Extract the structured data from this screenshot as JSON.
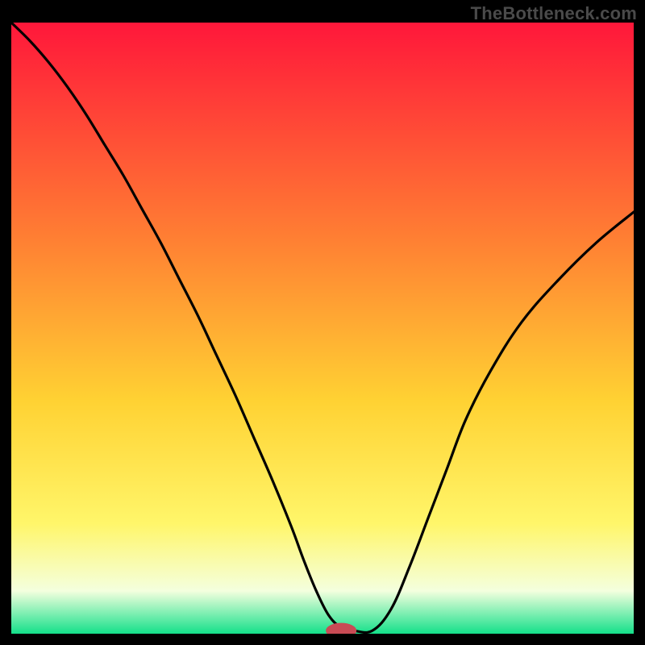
{
  "watermark": "TheBottleneck.com",
  "colors": {
    "gradient_top": "#ff173a",
    "gradient_mid_upper": "#ff7e33",
    "gradient_mid": "#ffd233",
    "gradient_mid_lower": "#fff66a",
    "gradient_light": "#f4ffde",
    "gradient_bottom": "#14e08a",
    "curve": "#000000",
    "marker": "#c94b55",
    "frame": "#000000"
  },
  "chart_data": {
    "type": "line",
    "title": "",
    "xlabel": "",
    "ylabel": "",
    "xlim": [
      0,
      100
    ],
    "ylim": [
      0,
      100
    ],
    "x": [
      0,
      3,
      6,
      9,
      12,
      15,
      18,
      21,
      24,
      27,
      30,
      33,
      36,
      39,
      42,
      45,
      47,
      49,
      51,
      53,
      55,
      58,
      61,
      64,
      67,
      70,
      73,
      77,
      82,
      88,
      94,
      100
    ],
    "values": [
      100,
      97,
      93.5,
      89.5,
      85,
      80,
      75,
      69.5,
      64,
      58,
      52,
      45.5,
      39,
      32,
      25,
      17.5,
      12,
      7,
      3,
      1,
      0.5,
      0.5,
      4,
      11,
      19,
      27,
      35,
      43,
      51,
      58,
      64,
      69
    ],
    "series": [
      {
        "name": "bottleneck-curve",
        "x_key": "x",
        "y_key": "values"
      }
    ],
    "marker": {
      "x": 53,
      "y": 0.5,
      "rx": 2.4,
      "ry": 1.2
    },
    "annotations": []
  }
}
